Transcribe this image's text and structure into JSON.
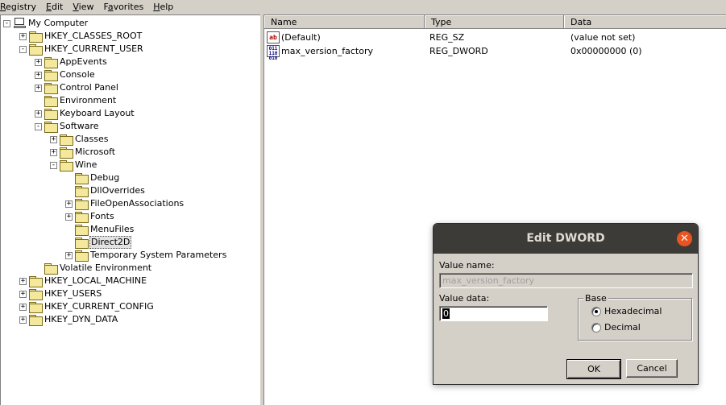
{
  "menu": [
    {
      "label": "Registry",
      "accel": "R"
    },
    {
      "label": "Edit",
      "accel": "E"
    },
    {
      "label": "View",
      "accel": "V"
    },
    {
      "label": "Favorites",
      "accel": "a"
    },
    {
      "label": "Help",
      "accel": "H"
    }
  ],
  "tree": {
    "root": "My Computer",
    "nodes": [
      {
        "label": "HKEY_CLASSES_ROOT",
        "depth": 1,
        "expander": "+"
      },
      {
        "label": "HKEY_CURRENT_USER",
        "depth": 1,
        "expander": "-"
      },
      {
        "label": "AppEvents",
        "depth": 2,
        "expander": "+"
      },
      {
        "label": "Console",
        "depth": 2,
        "expander": "+"
      },
      {
        "label": "Control Panel",
        "depth": 2,
        "expander": "+"
      },
      {
        "label": "Environment",
        "depth": 2,
        "expander": ""
      },
      {
        "label": "Keyboard Layout",
        "depth": 2,
        "expander": "+"
      },
      {
        "label": "Software",
        "depth": 2,
        "expander": "-"
      },
      {
        "label": "Classes",
        "depth": 3,
        "expander": "+"
      },
      {
        "label": "Microsoft",
        "depth": 3,
        "expander": "+"
      },
      {
        "label": "Wine",
        "depth": 3,
        "expander": "-"
      },
      {
        "label": "Debug",
        "depth": 4,
        "expander": ""
      },
      {
        "label": "DllOverrides",
        "depth": 4,
        "expander": ""
      },
      {
        "label": "FileOpenAssociations",
        "depth": 4,
        "expander": "+"
      },
      {
        "label": "Fonts",
        "depth": 4,
        "expander": "+"
      },
      {
        "label": "MenuFiles",
        "depth": 4,
        "expander": ""
      },
      {
        "label": "Direct2D",
        "depth": 4,
        "expander": "",
        "selected": true
      },
      {
        "label": "Temporary System Parameters",
        "depth": 4,
        "expander": "+"
      },
      {
        "label": "Volatile Environment",
        "depth": 2,
        "expander": ""
      },
      {
        "label": "HKEY_LOCAL_MACHINE",
        "depth": 1,
        "expander": "+"
      },
      {
        "label": "HKEY_USERS",
        "depth": 1,
        "expander": "+"
      },
      {
        "label": "HKEY_CURRENT_CONFIG",
        "depth": 1,
        "expander": "+"
      },
      {
        "label": "HKEY_DYN_DATA",
        "depth": 1,
        "expander": "+"
      }
    ]
  },
  "list": {
    "columns": {
      "name": "Name",
      "type": "Type",
      "data": "Data"
    },
    "rows": [
      {
        "icon": "string-value-icon",
        "name": "(Default)",
        "type": "REG_SZ",
        "data": "(value not set)"
      },
      {
        "icon": "dword-value-icon",
        "name": "max_version_factory",
        "type": "REG_DWORD",
        "data": "0x00000000 (0)"
      }
    ]
  },
  "dialog": {
    "title": "Edit DWORD",
    "value_name_label": "Value name:",
    "value_name": "max_version_factory",
    "value_data_label": "Value data:",
    "value_data": "0",
    "base_label": "Base",
    "hex_label": "Hexadecimal",
    "dec_label": "Decimal",
    "base_selected": "Hexadecimal",
    "ok": "OK",
    "cancel": "Cancel"
  }
}
